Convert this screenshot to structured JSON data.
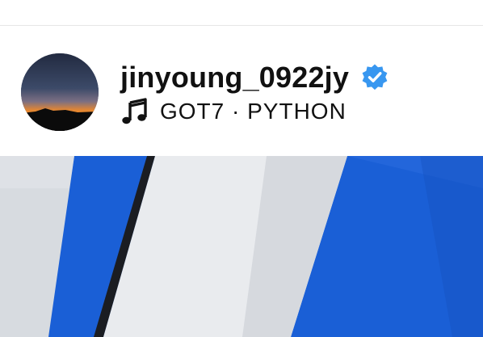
{
  "post": {
    "username": "jinyoung_0922jy",
    "verified": true,
    "audio_label": "GOT7 · PYTHON"
  },
  "icons": {
    "verified": "verified-badge-icon",
    "audio": "music-note-icon"
  },
  "colors": {
    "verified_badge": "#3897f0",
    "photo_blue": "#1a5fd6"
  }
}
